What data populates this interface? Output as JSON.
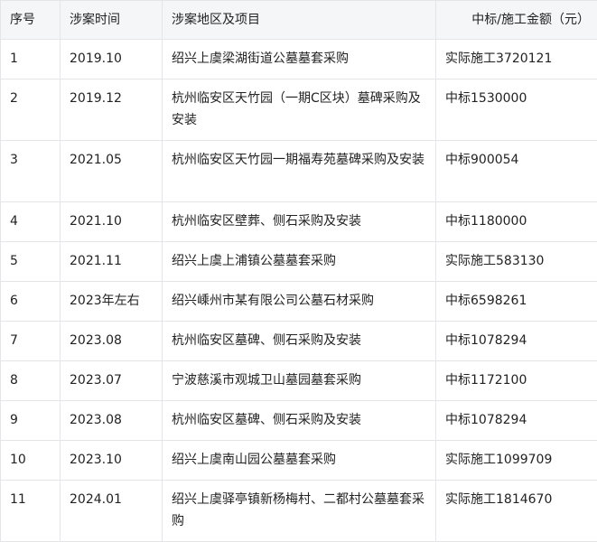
{
  "table": {
    "headers": [
      "序号",
      "涉案时间",
      "涉案地区及项目",
      "中标/施工金额（元）"
    ],
    "rows": [
      {
        "no": "1",
        "time": "2019.10",
        "project": "绍兴上虞梁湖街道公墓墓套采购",
        "amount": "实际施工3720121"
      },
      {
        "no": "2",
        "time": "2019.12",
        "project": "杭州临安区天竹园（一期C区块）墓碑采购及安装",
        "amount": "中标1530000"
      },
      {
        "no": "3",
        "time": "2021.05",
        "project": "杭州临安区天竹园一期福寿苑墓碑采购及安装",
        "amount": "中标900054"
      },
      {
        "no": "4",
        "time": "2021.10",
        "project": "杭州临安区壁葬、侧石采购及安装",
        "amount": "中标1180000"
      },
      {
        "no": "5",
        "time": "2021.11",
        "project": "绍兴上虞上浦镇公墓墓套采购",
        "amount": "实际施工583130"
      },
      {
        "no": "6",
        "time": "2023年左右",
        "project": "绍兴嵊州市某有限公司公墓石材采购",
        "amount": "中标6598261"
      },
      {
        "no": "7",
        "time": "2023.08",
        "project": "杭州临安区墓碑、侧石采购及安装",
        "amount": "中标1078294"
      },
      {
        "no": "8",
        "time": "2023.07",
        "project": "宁波慈溪市观城卫山墓园墓套采购",
        "amount": "中标1172100"
      },
      {
        "no": "9",
        "time": "2023.08",
        "project": "杭州临安区墓碑、侧石采购及安装",
        "amount": "中标1078294"
      },
      {
        "no": "10",
        "time": "2023.10",
        "project": "绍兴上虞南山园公墓墓套采购",
        "amount": "实际施工1099709"
      },
      {
        "no": "11",
        "time": "2024.01",
        "project": "绍兴上虞驿亭镇新杨梅村、二都村公墓墓套采购",
        "amount": "实际施工1814670"
      }
    ]
  }
}
